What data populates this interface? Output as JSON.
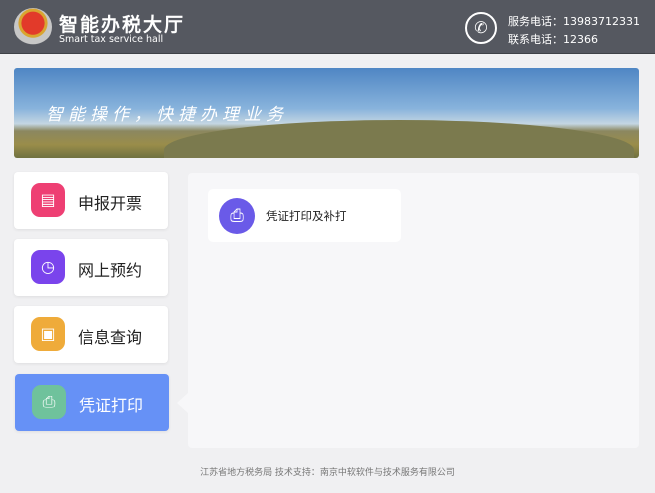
{
  "header": {
    "title": "智能办税大厅",
    "subtitle": "Smart tax service hall",
    "service_phone": "服务电话：13983712331",
    "contact_phone": "联系电话：12366"
  },
  "banner": {
    "slogan": "智能操作，快捷办理业务"
  },
  "nav": [
    {
      "label": "申报开票",
      "icon": "clipboard-icon",
      "color": "#ee3f73"
    },
    {
      "label": "网上预约",
      "icon": "clock-icon",
      "color": "#7a44ec"
    },
    {
      "label": "信息查询",
      "icon": "contact-card-icon",
      "color": "#efab3a"
    },
    {
      "label": "凭证打印",
      "icon": "printer-icon",
      "color": "#6fc29c",
      "active": true
    }
  ],
  "content": {
    "cards": [
      {
        "label": "凭证打印及补打",
        "icon": "printer-icon"
      }
    ]
  },
  "footer": {
    "text": "江苏省地方税务局 技术支持：南京中软软件与技术服务有限公司"
  }
}
